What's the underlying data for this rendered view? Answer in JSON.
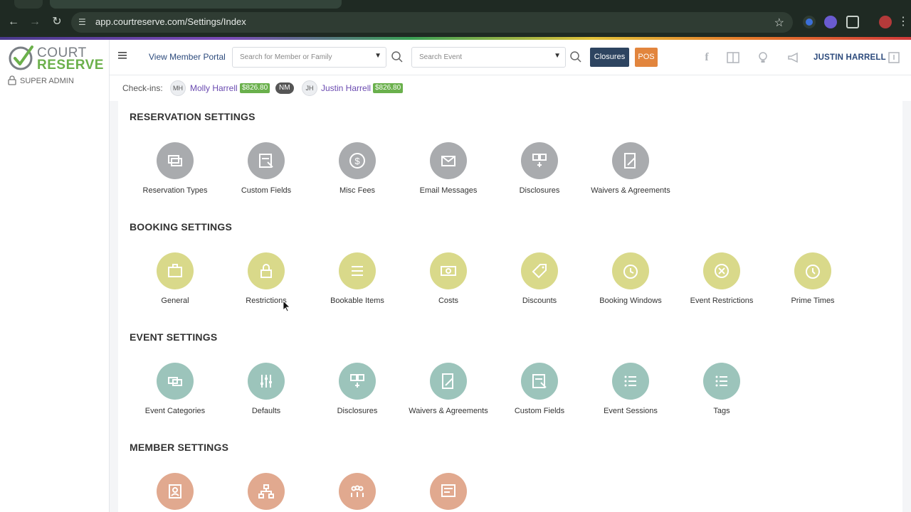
{
  "browser": {
    "url": "app.courtreserve.com/Settings/Index"
  },
  "brand": {
    "word1": "COURT",
    "word2": "RESERVE",
    "role": "SUPER ADMIN",
    "colors": {
      "green": "#6bb04b",
      "grey": "#7a7f85"
    }
  },
  "header": {
    "portal_link": "View Member Portal",
    "member_search_placeholder": "Search for Member or Family",
    "event_search_placeholder": "Search Event",
    "closures_label": "Closures",
    "pos_label": "POS",
    "user_name": "JUSTIN HARRELL"
  },
  "checkins": {
    "label": "Check-ins:",
    "people": [
      {
        "initials": "MH",
        "name": "Molly Harrell",
        "balance": "$826.80",
        "tag": "NM"
      },
      {
        "initials": "JH",
        "name": "Justin Harrell",
        "balance": "$826.80"
      }
    ]
  },
  "sections": [
    {
      "title": "RESERVATION SETTINGS",
      "items": [
        "Reservation Types",
        "Custom Fields",
        "Misc Fees",
        "Email Messages",
        "Disclosures",
        "Waivers & Agreements"
      ]
    },
    {
      "title": "BOOKING SETTINGS",
      "items": [
        "General",
        "Restrictions",
        "Bookable Items",
        "Costs",
        "Discounts",
        "Booking Windows",
        "Event Restrictions",
        "Prime Times"
      ]
    },
    {
      "title": "EVENT SETTINGS",
      "items": [
        "Event Categories",
        "Defaults",
        "Disclosures",
        "Waivers & Agreements",
        "Custom Fields",
        "Event Sessions",
        "Tags"
      ]
    },
    {
      "title": "MEMBER SETTINGS",
      "items": [
        "",
        "",
        "",
        ""
      ]
    }
  ]
}
